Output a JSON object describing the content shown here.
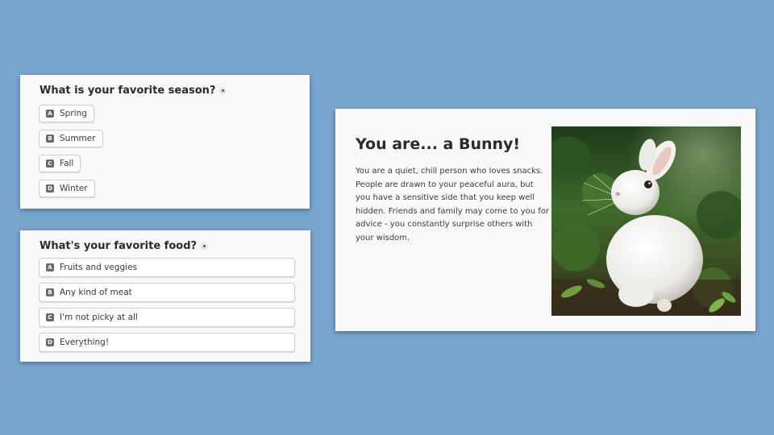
{
  "quiz": {
    "season": {
      "question": "What is your favorite season?",
      "options": [
        {
          "key": "A",
          "label": "Spring"
        },
        {
          "key": "B",
          "label": "Summer"
        },
        {
          "key": "C",
          "label": "Fall"
        },
        {
          "key": "D",
          "label": "Winter"
        }
      ]
    },
    "food": {
      "question": "What's your favorite food?",
      "options": [
        {
          "key": "A",
          "label": "Fruits and veggies"
        },
        {
          "key": "B",
          "label": "Any kind of meat"
        },
        {
          "key": "C",
          "label": "I'm not picky at all"
        },
        {
          "key": "D",
          "label": "Everything!"
        }
      ]
    }
  },
  "result": {
    "title": "You are... a Bunny!",
    "description": "You are a quiet, chill person who loves snacks. People are drawn to your peaceful aura, but you have a sensitive side that you keep well hidden. Friends and family may come to you for advice - you constantly surprise others with your wisdom."
  },
  "colors": {
    "background": "#78a6cd",
    "card": "#f8f8f8",
    "key_badge": "#6b6b6b"
  },
  "icons": {
    "question_info": "info-dot-icon",
    "result_image": "white-bunny-photo"
  }
}
